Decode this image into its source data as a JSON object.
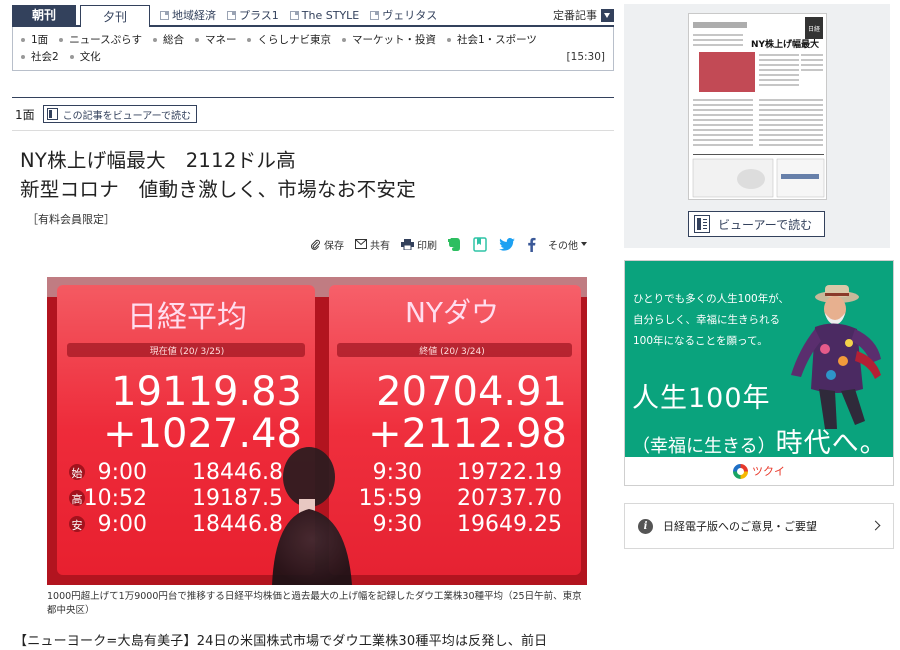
{
  "nav": {
    "tabs": [
      {
        "label": "朝刊",
        "active": true
      },
      {
        "label": "夕刊",
        "active": false
      }
    ],
    "external_links": [
      "地域経済",
      "プラス1",
      "The STYLE",
      "ヴェリタス"
    ],
    "featured_label": "定番記事",
    "sections_row1": [
      "1面",
      "ニュースぷらす",
      "総合",
      "マネー",
      "くらしナビ東京",
      "マーケット・投資",
      "社会1・スポーツ"
    ],
    "sections_row2": [
      "社会2",
      "文化"
    ],
    "time": "[15:30]"
  },
  "article": {
    "page_label": "1面",
    "viewer_label": "この記事をビューアーで読む",
    "headline_line1": "NY株上げ幅最大　2112ドル高",
    "headline_line2": "新型コロナ　値動き激しく、市場なお不安定",
    "members_only": "［有料会員限定］",
    "share": {
      "save": "保存",
      "share": "共有",
      "print": "印刷",
      "more": "その他"
    },
    "photo": {
      "left_board": {
        "title": "日経平均",
        "sublabel": "現在値 (20/ 3/25)",
        "value": "19119.83",
        "change": "+1027.48",
        "rows": [
          {
            "label": "始",
            "time": "9:00",
            "value": "18446.8"
          },
          {
            "label": "高",
            "time": "10:52",
            "value": "19187.5"
          },
          {
            "label": "安",
            "time": "9:00",
            "value": "18446.8"
          }
        ]
      },
      "right_board": {
        "title": "NYダウ",
        "sublabel": "終値 (20/ 3/24)",
        "value": "20704.91",
        "change": "+2112.98",
        "rows": [
          {
            "time": "9:30",
            "value": "19722.19"
          },
          {
            "time": "15:59",
            "value": "20737.70"
          },
          {
            "time": "9:30",
            "value": "19649.25"
          }
        ]
      }
    },
    "caption": "1000円超上げて1万9000円台で推移する日経平均株価と過去最大の上げ幅を記録したダウ工業株30種平均（25日午前、東京都中央区）",
    "body_first_line": "【ニューヨーク=大島有美子】24日の米国株式市場でダウ工業株30種平均は反発し、前日"
  },
  "sidebar": {
    "paper_headline": "NY株上げ幅最大",
    "viewer_button": "ビューアーで読む",
    "ad": {
      "copy_lines": [
        "ひとりでも多くの人生100年が、",
        "自分らしく、幸福に生きられる",
        "100年になることを願って。"
      ],
      "big_line1": "人生100年",
      "big_line2_small": "（幸福に生きる）",
      "big_line2_large": "時代へ。",
      "brand": "ツクイ",
      "colors": {
        "background": "#0aa37d",
        "brand": "#e8382a"
      }
    },
    "feedback_label": "日経電子版へのご意見・ご要望"
  },
  "colors": {
    "navy": "#33415c",
    "board_red": "#e8202f"
  }
}
